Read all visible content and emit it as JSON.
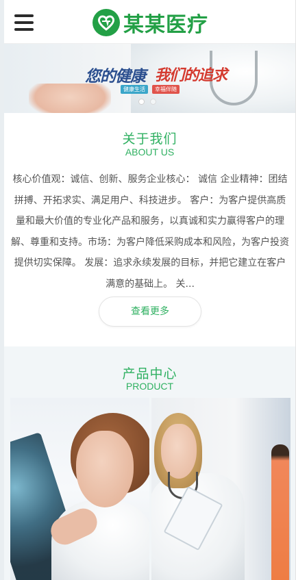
{
  "header": {
    "menu_icon": "hamburger-menu-icon",
    "logo_icon": "heart-leaf-logo-icon",
    "logo_text": "某某医疗",
    "brand_color": "#23a046"
  },
  "banner": {
    "slogan_left": "您的健康",
    "slogan_right": "我们的追求",
    "tags": [
      "健康生活",
      "幸福伴随"
    ],
    "slide_count": 2,
    "active_slide": 1
  },
  "about": {
    "title": "关于我们",
    "subtitle": "ABOUT US",
    "body": "核心价值观：诚信、创新、服务企业核心： 诚信 企业精神：团结拼搏、开拓求实、满足用户、科技进步。 客户：为客户提供高质量和最大价值的专业化产品和服务，以真诚和实力赢得客户的理解、尊重和支持。市场：为客户降低采购成本和风险，为客户投资提供切实保障。 发展：追求永续发展的目标，并把它建立在客户满意的基础上。 关...",
    "more_button": "查看更多",
    "accent_color": "#2fb061"
  },
  "product": {
    "title": "产品中心",
    "subtitle": "PRODUCT"
  }
}
